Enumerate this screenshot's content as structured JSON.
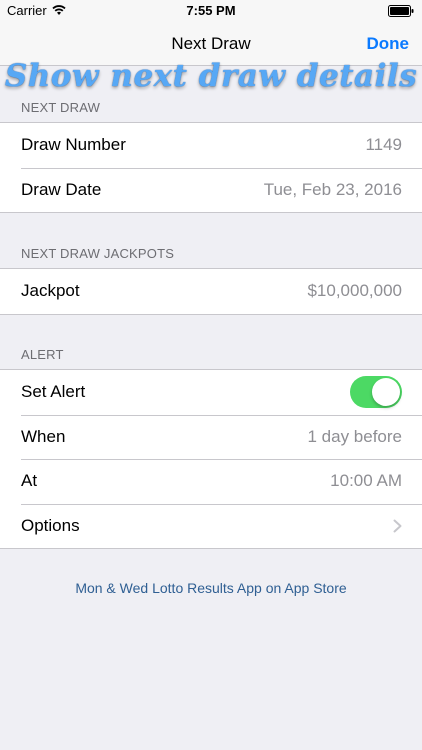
{
  "status_bar": {
    "carrier": "Carrier",
    "time": "7:55 PM"
  },
  "nav": {
    "title": "Next Draw",
    "done_label": "Done"
  },
  "banner": "Show next draw details",
  "sections": {
    "next_draw": {
      "header": "NEXT DRAW",
      "rows": [
        {
          "label": "Draw Number",
          "value": "1149"
        },
        {
          "label": "Draw Date",
          "value": "Tue, Feb 23, 2016"
        }
      ]
    },
    "jackpots": {
      "header": "NEXT DRAW JACKPOTS",
      "rows": [
        {
          "label": "Jackpot",
          "value": "$10,000,000"
        }
      ]
    },
    "alert": {
      "header": "ALERT",
      "rows": [
        {
          "label": "Set Alert",
          "toggle_on": true
        },
        {
          "label": "When",
          "value": "1 day before"
        },
        {
          "label": "At",
          "value": "10:00 AM"
        },
        {
          "label": "Options"
        }
      ]
    }
  },
  "footer_link": "Mon & Wed Lotto Results App on App Store",
  "colors": {
    "accent": "#0a7aff",
    "toggle_on": "#4cd964",
    "banner": "#57a8f5",
    "footer_link": "#2f5f93"
  },
  "icons": {
    "wifi": "wifi-icon",
    "battery": "battery-icon",
    "chevron": "chevron-right-icon"
  }
}
